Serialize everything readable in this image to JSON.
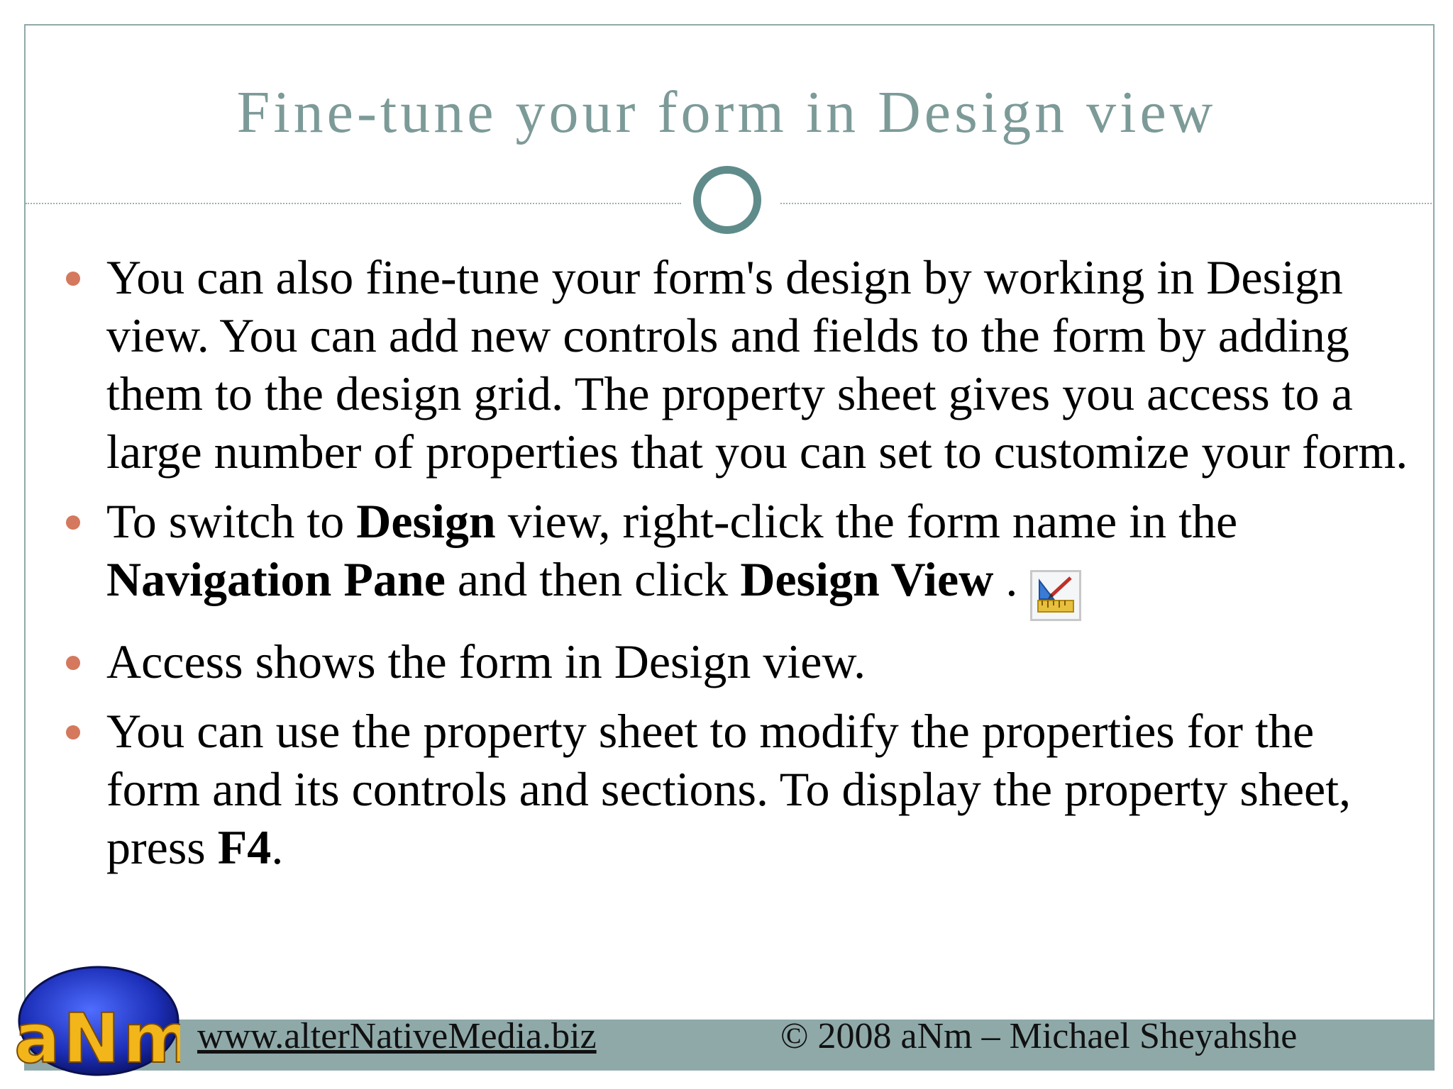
{
  "slide": {
    "title": "Fine-tune your form in Design view",
    "bullets": [
      {
        "text": "You can also fine-tune your form's design by working in Design view. You can add new controls and fields to the form by adding them to the design grid. The property sheet gives you access to a large number of properties that you can set to customize your form."
      },
      {
        "part1": "To switch to ",
        "bold1": "Design",
        "part2": " view, right-click the form name in the ",
        "bold2": "Navigation Pane",
        "part3": " and then click ",
        "bold3": "Design View",
        "part4": " .",
        "icon": "design-view-icon"
      },
      {
        "text": "Access shows the form in Design view."
      },
      {
        "part1": "You can use the property sheet to modify the properties for the form and its controls and sections. To display the property sheet, press ",
        "bold1": "F4",
        "part2": "."
      }
    ]
  },
  "footer": {
    "url": "www.alterNativeMedia.biz",
    "copyright": "© 2008 aNm – Michael Sheyahshe",
    "logo_text": "aNm"
  },
  "colors": {
    "title": "#7c9a98",
    "accent_ring": "#5f8c8a",
    "bullet": "#d4785e",
    "footer_bar": "#8fa9a9"
  }
}
